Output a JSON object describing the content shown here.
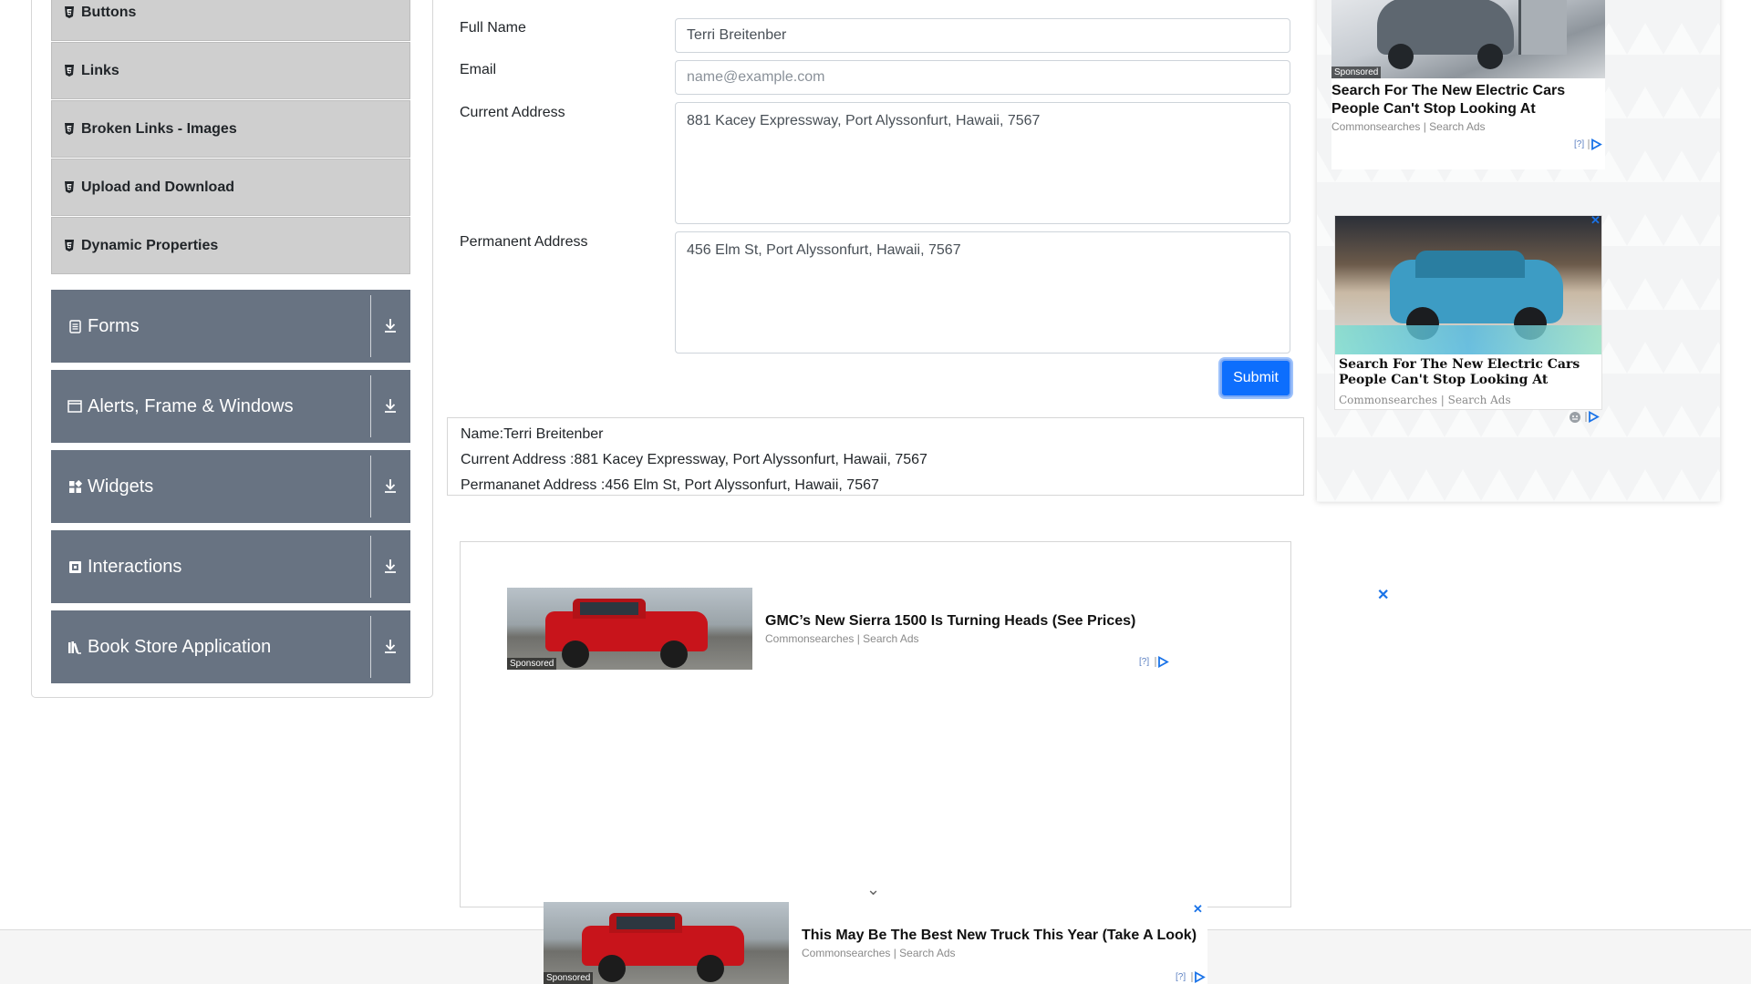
{
  "sidebar": {
    "elements_sub_items": [
      {
        "label": "Buttons"
      },
      {
        "label": "Links"
      },
      {
        "label": "Broken Links - Images"
      },
      {
        "label": "Upload and Download"
      },
      {
        "label": "Dynamic Properties"
      }
    ],
    "groups": [
      {
        "label": "Forms",
        "icon": "form-icon"
      },
      {
        "label": "Alerts, Frame & Windows",
        "icon": "window-icon"
      },
      {
        "label": "Widgets",
        "icon": "widgets-icon"
      },
      {
        "label": "Interactions",
        "icon": "interactions-icon"
      },
      {
        "label": "Book Store Application",
        "icon": "book-icon"
      }
    ]
  },
  "form": {
    "full_name_label": "Full Name",
    "full_name_value": "Terri Breitenber",
    "email_label": "Email",
    "email_placeholder": "name@example.com",
    "current_address_label": "Current Address",
    "current_address_value": "881 Kacey Expressway, Port Alyssonfurt, Hawaii, 7567",
    "permanent_address_label": "Permanent Address",
    "permanent_address_value": "456 Elm St, Port Alyssonfurt, Hawaii, 7567",
    "submit_label": "Submit"
  },
  "output": {
    "name": "Name:Terri Breitenber",
    "current_address": "Current Address :881 Kacey Expressway, Port Alyssonfurt, Hawaii, 7567",
    "permanent_address": "Permananet Address :456 Elm St, Port Alyssonfurt, Hawaii, 7567"
  },
  "ads": {
    "center": {
      "title": "GMC’s New Sierra 1500 Is Turning Heads (See Prices)",
      "source": "Commonsearches | Search Ads",
      "sponsored": "Sponsored",
      "info": "[?]"
    },
    "right_top": {
      "title": "Search For The New Electric Cars People Can't Stop Looking At",
      "source": "Commonsearches | Search Ads",
      "sponsored": "Sponsored",
      "info": "[?]"
    },
    "right_second": {
      "title": "Search For The New Electric Cars People Can't Stop Looking At",
      "source": "Commonsearches | Search Ads"
    },
    "bottom": {
      "title": "This May Be The Best New Truck This Year (Take A Look)",
      "source": "Commonsearches | Search Ads",
      "sponsored": "Sponsored",
      "info": "[?]"
    },
    "close_glyph": "✕",
    "expand_glyph": "⌄"
  },
  "colors": {
    "sidebar_group_bg": "#687382",
    "sub_item_bg": "#cfcfcf",
    "submit_bg": "#0d6efd",
    "adchoices": "#1a73e8"
  }
}
